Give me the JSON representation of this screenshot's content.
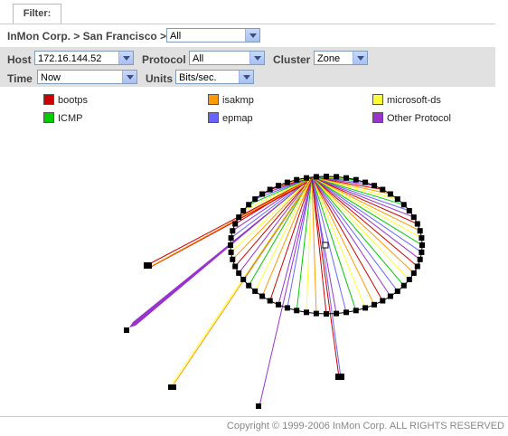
{
  "filter_tab": {
    "label": "Filter:"
  },
  "breadcrumb": {
    "text": "InMon Corp. > San Francisco >",
    "selected": "All"
  },
  "controls": {
    "host": {
      "label": "Host",
      "value": "172.16.144.52"
    },
    "protocol": {
      "label": "Protocol",
      "value": "All"
    },
    "cluster": {
      "label": "Cluster",
      "value": "Zone"
    },
    "time": {
      "label": "Time",
      "value": "Now"
    },
    "units": {
      "label": "Units",
      "value": "Bits/sec."
    }
  },
  "legend": [
    {
      "label": "bootps",
      "color": "#cc0000"
    },
    {
      "label": "isakmp",
      "color": "#ff9900"
    },
    {
      "label": "microsoft-ds",
      "color": "#ffff33"
    },
    {
      "label": "ICMP",
      "color": "#00cc00"
    },
    {
      "label": "epmap",
      "color": "#6666ff"
    },
    {
      "label": "Other Protocol",
      "color": "#9933cc"
    }
  ],
  "footer": {
    "copyright": "Copyright © 1999-2006 InMon Corp. ALL RIGHTS RESERVED"
  }
}
